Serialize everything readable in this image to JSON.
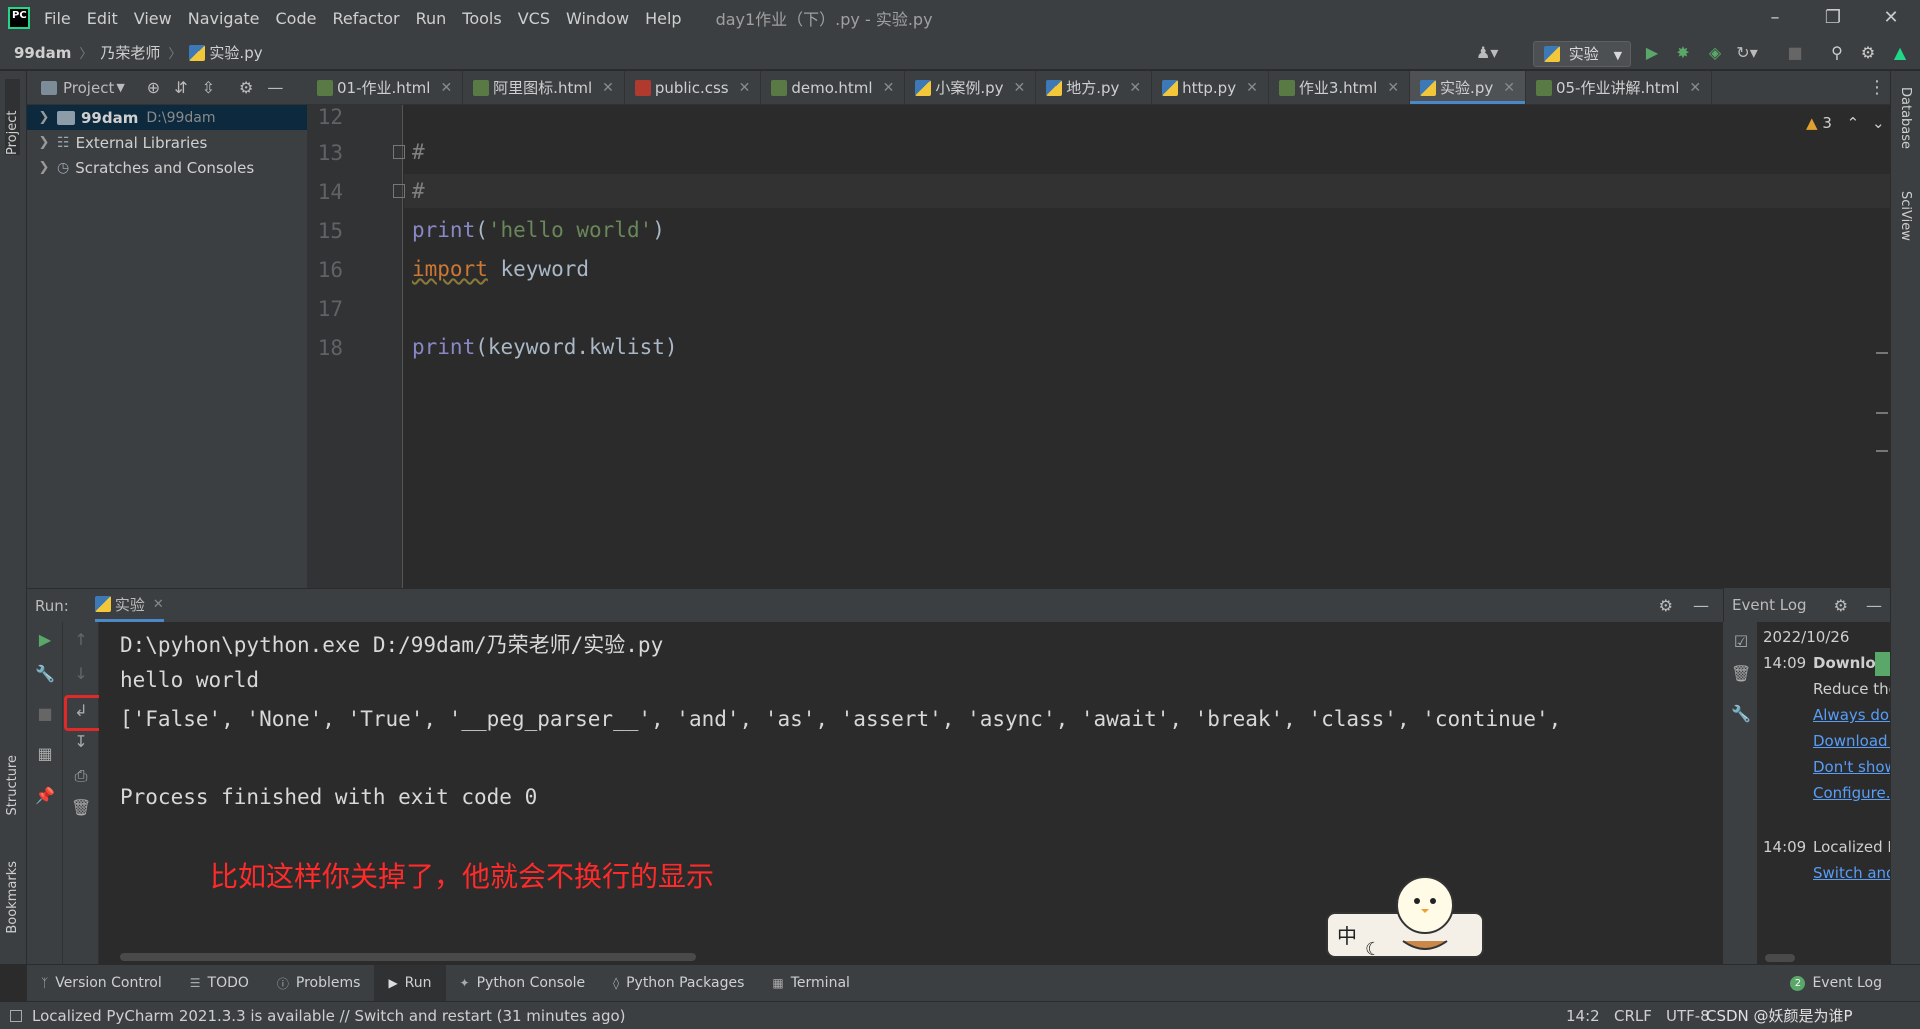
{
  "menubar": {
    "items": [
      "File",
      "Edit",
      "View",
      "Navigate",
      "Code",
      "Refactor",
      "Run",
      "Tools",
      "VCS",
      "Window",
      "Help"
    ],
    "window_title": "day1作业（下）.py - 实验.py"
  },
  "navbar": {
    "crumbs": [
      "99dam",
      "乃荣老师",
      "实验.py"
    ],
    "run_config": "实验"
  },
  "left_strip": {
    "project": "Project",
    "structure": "Structure",
    "bookmarks": "Bookmarks"
  },
  "right_strip": {
    "database": "Database",
    "sciview": "SciView"
  },
  "project": {
    "title": "Project",
    "tree": [
      {
        "label": "99dam",
        "path": "D:\\99dam"
      },
      {
        "label": "External Libraries",
        "path": ""
      },
      {
        "label": "Scratches and Consoles",
        "path": ""
      }
    ]
  },
  "tabs": [
    {
      "label": "01-作业.html",
      "type": "html"
    },
    {
      "label": "阿里图标.html",
      "type": "html"
    },
    {
      "label": "public.css",
      "type": "css"
    },
    {
      "label": "demo.html",
      "type": "html"
    },
    {
      "label": "小案例.py",
      "type": "py"
    },
    {
      "label": "地方.py",
      "type": "py"
    },
    {
      "label": "http.py",
      "type": "py"
    },
    {
      "label": "作业3.html",
      "type": "html"
    },
    {
      "label": "实验.py",
      "type": "py",
      "active": true
    },
    {
      "label": "05-作业讲解.html",
      "type": "html"
    }
  ],
  "editor": {
    "warnings": "3",
    "lines": [
      {
        "no": "12",
        "code": ""
      },
      {
        "no": "13",
        "code": "#"
      },
      {
        "no": "14",
        "code": "#"
      },
      {
        "no": "15",
        "code": "print('hello world')"
      },
      {
        "no": "16",
        "code": "import keyword"
      },
      {
        "no": "17",
        "code": ""
      },
      {
        "no": "18",
        "code": "print(keyword.kwlist)"
      }
    ]
  },
  "run": {
    "label": "Run:",
    "tab": "实验",
    "output": [
      "D:\\pyhon\\python.exe D:/99dam/乃荣老师/实验.py",
      "hello world",
      "['False', 'None', 'True', '__peg_parser__', 'and', 'as', 'assert', 'async', 'await', 'break', 'class', 'continue',",
      "",
      "Process finished with exit code 0"
    ],
    "annotation": "比如这样你关掉了，他就会不换行的显示"
  },
  "event_log": {
    "title": "Event Log",
    "date": "2022/10/26",
    "entries": [
      {
        "time": "14:09",
        "title": "Downloa",
        "text": "Reduce the",
        "links": [
          "Always dow",
          "Download c",
          "Don't show",
          "Configure..."
        ]
      },
      {
        "time": "14:09",
        "title": "Localized P",
        "links": [
          "Switch and"
        ]
      }
    ]
  },
  "bottom_tools": [
    "Version Control",
    "TODO",
    "Problems",
    "Run",
    "Python Console",
    "Python Packages",
    "Terminal"
  ],
  "event_log_button": {
    "count": "2",
    "label": "Event Log"
  },
  "status": {
    "message": "Localized PyCharm 2021.3.3 is available // Switch and restart (31 minutes ago)",
    "position": "14:2",
    "line_sep": "CRLF",
    "encoding": "UTF-8",
    "watermark": "CSDN @妖颜是为谁P"
  },
  "colors": {
    "accent": "#4a88c7",
    "annotation": "#ff2a2a",
    "run_green": "#59a869"
  }
}
